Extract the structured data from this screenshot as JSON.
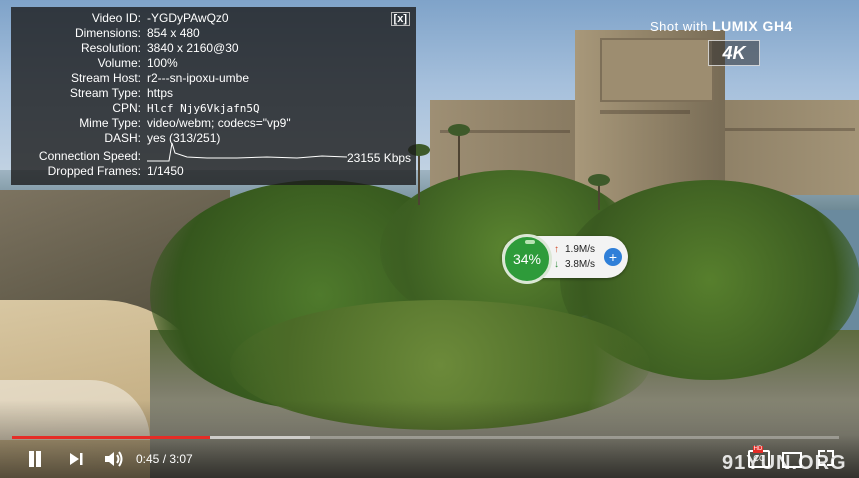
{
  "watermark": {
    "shot_prefix": "Shot with",
    "shot_brand": "LUMIX GH4",
    "badge": "4K",
    "site": "91YUN.ORG"
  },
  "stats": {
    "close_label": "[x]",
    "rows": [
      {
        "label": "Video ID:",
        "value": "-YGDyPAwQz0"
      },
      {
        "label": "Dimensions:",
        "value": "854 x 480"
      },
      {
        "label": "Resolution:",
        "value": "3840 x 2160@30"
      },
      {
        "label": "Volume:",
        "value": "100%"
      },
      {
        "label": "Stream Host:",
        "value": "r2---sn-ipoxu-umbe"
      },
      {
        "label": "Stream Type:",
        "value": "https"
      },
      {
        "label": "CPN:",
        "value": "Hlcf Njy6Vkjafn5Q"
      },
      {
        "label": "Mime Type:",
        "value": "video/webm; codecs=\"vp9\""
      },
      {
        "label": "DASH:",
        "value": "yes (313/251)"
      },
      {
        "label": "Connection Speed:",
        "value": "23155 Kbps"
      },
      {
        "label": "Dropped Frames:",
        "value": "1/1450"
      }
    ]
  },
  "network_widget": {
    "usage": "34%",
    "upload": "1.9M/s",
    "download": "3.8M/s",
    "up_arrow": "↑",
    "down_arrow": "↓",
    "plus": "+"
  },
  "controls": {
    "time": "0:45 / 3:07",
    "played_fraction": 0.24,
    "buffered_fraction": 0.36,
    "cc_label": "CC",
    "hd_label": "HD"
  },
  "colors": {
    "progress_played": "#e52d27",
    "gauge": "#2e9b3a",
    "plus_button": "#2f7fd8"
  }
}
